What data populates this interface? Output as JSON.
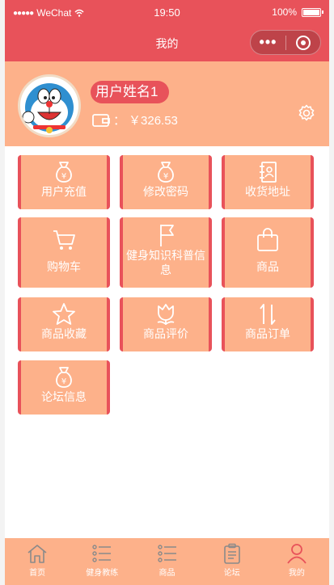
{
  "status_bar": {
    "carrier": "WeChat",
    "time": "19:50",
    "battery": "100%"
  },
  "nav": {
    "title": "我的"
  },
  "profile": {
    "username": "用户姓名1",
    "colon": "：",
    "balance": "￥326.53"
  },
  "menu": [
    {
      "label": "用户充值",
      "icon": "money-bag-icon"
    },
    {
      "label": "修改密码",
      "icon": "money-bag-icon"
    },
    {
      "label": "收货地址",
      "icon": "address-book-icon"
    },
    {
      "label": "购物车",
      "icon": "cart-icon"
    },
    {
      "label": "健身知识科普信息",
      "icon": "flag-icon"
    },
    {
      "label": "商品",
      "icon": "shopping-bag-icon"
    },
    {
      "label": "商品收藏",
      "icon": "star-icon"
    },
    {
      "label": "商品评价",
      "icon": "tulip-icon"
    },
    {
      "label": "商品订单",
      "icon": "sort-icon"
    },
    {
      "label": "论坛信息",
      "icon": "money-bag-icon"
    }
  ],
  "tabbar": [
    {
      "label": "首页",
      "icon": "home-icon"
    },
    {
      "label": "健身教练",
      "icon": "list-icon"
    },
    {
      "label": "商品",
      "icon": "list-icon"
    },
    {
      "label": "论坛",
      "icon": "clipboard-icon"
    },
    {
      "label": "我的",
      "icon": "user-icon"
    }
  ],
  "colors": {
    "primary": "#e8525a",
    "peach": "#fdb18a"
  }
}
